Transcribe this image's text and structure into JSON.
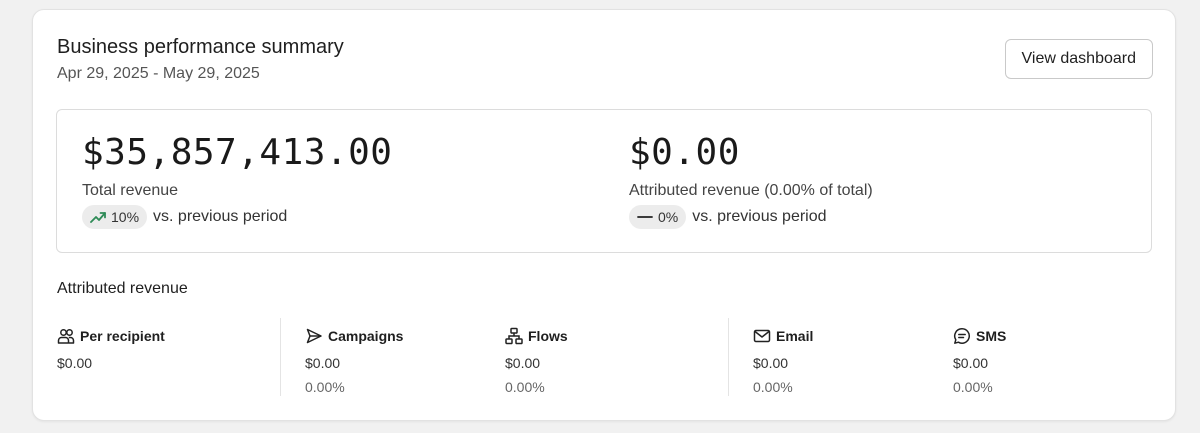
{
  "header": {
    "title": "Business performance summary",
    "date_range": "Apr 29, 2025 - May 29, 2025",
    "view_dashboard_label": "View dashboard"
  },
  "summary": {
    "total": {
      "value": "$35,857,413.00",
      "label": "Total revenue",
      "change": "10%",
      "change_icon": "trending-up-icon",
      "vs_text": "vs. previous period"
    },
    "attributed": {
      "value": "$0.00",
      "label": "Attributed revenue (0.00% of total)",
      "change": "0%",
      "change_icon": "dash-icon",
      "vs_text": "vs. previous period"
    }
  },
  "attributed_section": {
    "title": "Attributed revenue",
    "columns": [
      {
        "label": "Per recipient",
        "icon": "people-icon",
        "value": "$0.00"
      },
      {
        "label": "Campaigns",
        "icon": "send-icon",
        "value": "$0.00",
        "percent": "0.00%"
      },
      {
        "label": "Flows",
        "icon": "flow-icon",
        "value": "$0.00",
        "percent": "0.00%"
      },
      {
        "label": "Email",
        "icon": "mail-icon",
        "value": "$0.00",
        "percent": "0.00%"
      },
      {
        "label": "SMS",
        "icon": "sms-icon",
        "value": "$0.00",
        "percent": "0.00%"
      }
    ]
  },
  "colors": {
    "positive_trend": "#2e8b57"
  }
}
